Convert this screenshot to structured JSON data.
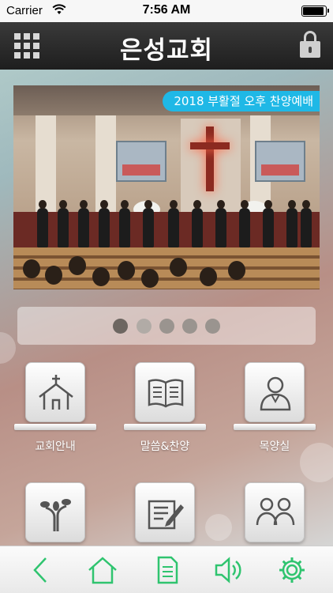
{
  "status_bar": {
    "carrier": "Carrier",
    "time": "7:56 AM",
    "battery_level": 0.95
  },
  "header": {
    "title": "은성교회",
    "left_icon": "grid-menu-icon",
    "right_icon": "lock-icon"
  },
  "banner": {
    "caption": "2018 부활절 오후 찬양예배",
    "caption_color": "#1fb8e6"
  },
  "pager": {
    "page_count": 5,
    "active_index": 0
  },
  "menu": {
    "items": [
      {
        "label": "교회안내",
        "icon": "church-icon"
      },
      {
        "label": "말씀&찬양",
        "icon": "book-icon"
      },
      {
        "label": "목양실",
        "icon": "pastor-icon"
      },
      {
        "label": "",
        "icon": "tree-icon"
      },
      {
        "label": "",
        "icon": "notepad-pen-icon"
      },
      {
        "label": "",
        "icon": "people-icon"
      }
    ]
  },
  "toolbar": {
    "accent_color": "#2fc46f",
    "items": [
      {
        "icon": "back-arrow-icon"
      },
      {
        "icon": "home-icon"
      },
      {
        "icon": "document-icon"
      },
      {
        "icon": "speaker-icon"
      },
      {
        "icon": "settings-gear-icon"
      }
    ]
  }
}
